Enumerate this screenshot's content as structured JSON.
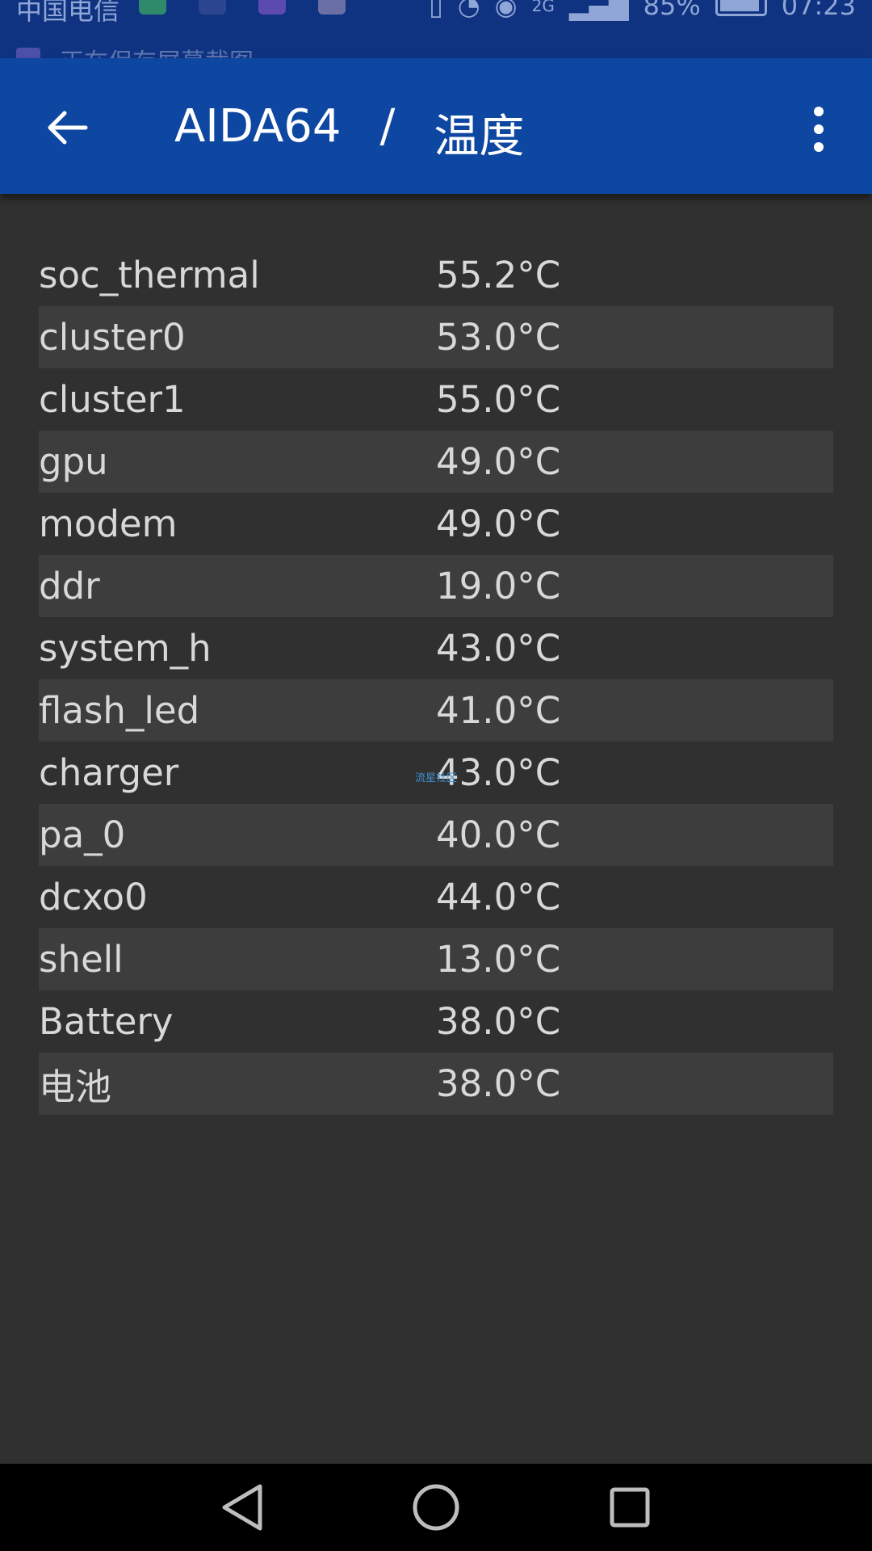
{
  "status_bar": {
    "carrier": "中国电信",
    "network": "2G",
    "battery": "85%",
    "time": "07:23",
    "notification_text": "正在保存屏幕截图"
  },
  "app_bar": {
    "app_name": "AIDA64",
    "separator": "/",
    "section": "温度"
  },
  "sensors": [
    {
      "name": "soc_thermal",
      "value": "55.2°C"
    },
    {
      "name": "cluster0",
      "value": "53.0°C"
    },
    {
      "name": "cluster1",
      "value": "55.0°C"
    },
    {
      "name": "gpu",
      "value": "49.0°C"
    },
    {
      "name": "modem",
      "value": "49.0°C"
    },
    {
      "name": "ddr",
      "value": "19.0°C"
    },
    {
      "name": "system_h",
      "value": "43.0°C"
    },
    {
      "name": "flash_led",
      "value": "41.0°C"
    },
    {
      "name": "charger",
      "value": "43.0°C"
    },
    {
      "name": "pa_0",
      "value": "40.0°C"
    },
    {
      "name": "dcxo0",
      "value": "44.0°C"
    },
    {
      "name": "shell",
      "value": "13.0°C"
    },
    {
      "name": "Battery",
      "value": "38.0°C"
    },
    {
      "name": "电池",
      "value": "38.0°C"
    }
  ],
  "watermark": "流星社区",
  "icons": {
    "back": "arrow-back-icon",
    "menu": "more-vert-icon",
    "nav_back": "triangle-back-icon",
    "nav_home": "circle-home-icon",
    "nav_recents": "square-recents-icon"
  },
  "colors": {
    "app_bar": "#0d47a1",
    "background": "#303030",
    "row_alt": "#3d3d3d",
    "text": "#d8d8d8"
  }
}
